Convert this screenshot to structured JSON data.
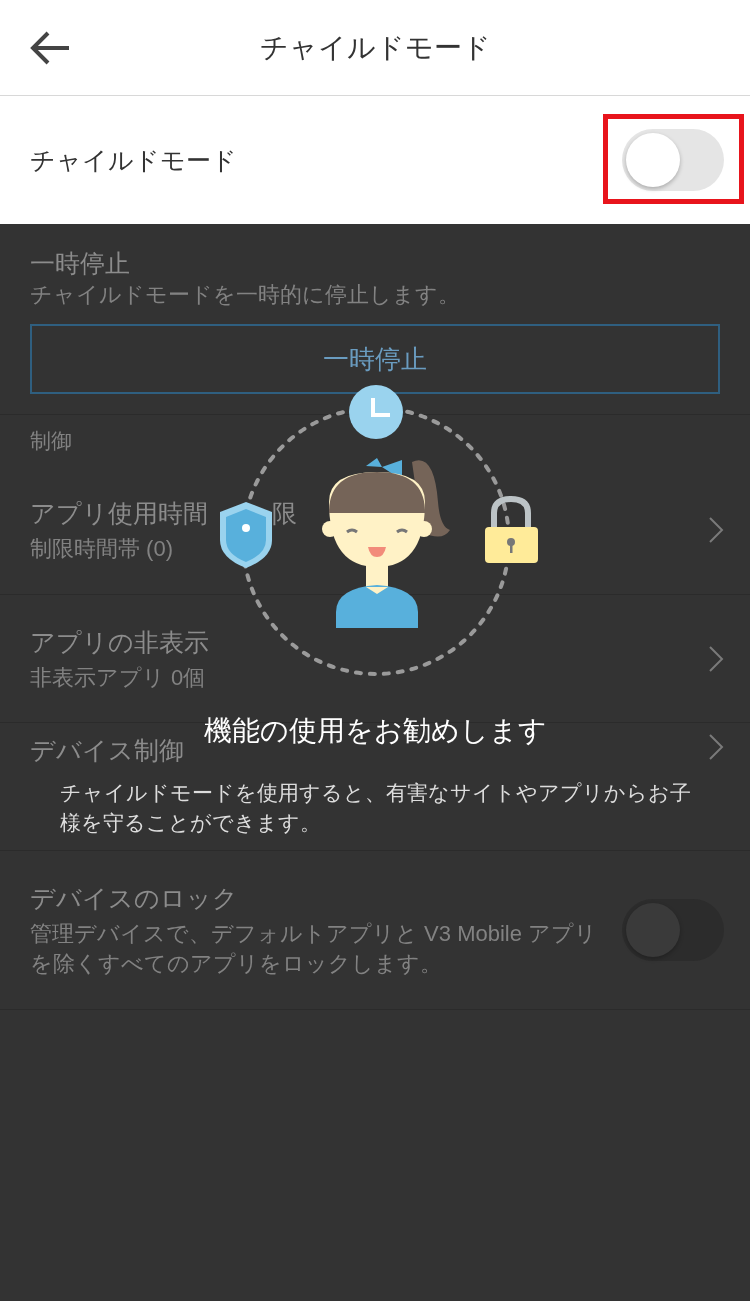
{
  "header": {
    "title": "チャイルドモード"
  },
  "child_mode": {
    "label": "チャイルドモード",
    "on": false,
    "highlighted": true
  },
  "pause": {
    "title": "一時停止",
    "description": "チャイルドモードを一時的に停止します。",
    "button": "一時停止"
  },
  "section_label": "制御",
  "rows": [
    {
      "kind": "link",
      "title": "アプリ使用時間",
      "title_tail": "限",
      "subtitle": "制限時間帯 (0)"
    },
    {
      "kind": "link",
      "title": "アプリの非表示",
      "subtitle": "非表示アプリ 0個"
    },
    {
      "kind": "link",
      "title": "デバイス制御"
    },
    {
      "kind": "toggle",
      "title": "デバイスのロック",
      "subtitle": "管理デバイスで、デフォルトアプリと V3 Mobile アプリを除くすべてのアプリをロックします。",
      "on": false
    }
  ],
  "overlay": {
    "headline": "機能の使用をお勧めします",
    "message": "チャイルドモードを使用すると、有害なサイトやアプリからお子様を守ることができます。"
  }
}
